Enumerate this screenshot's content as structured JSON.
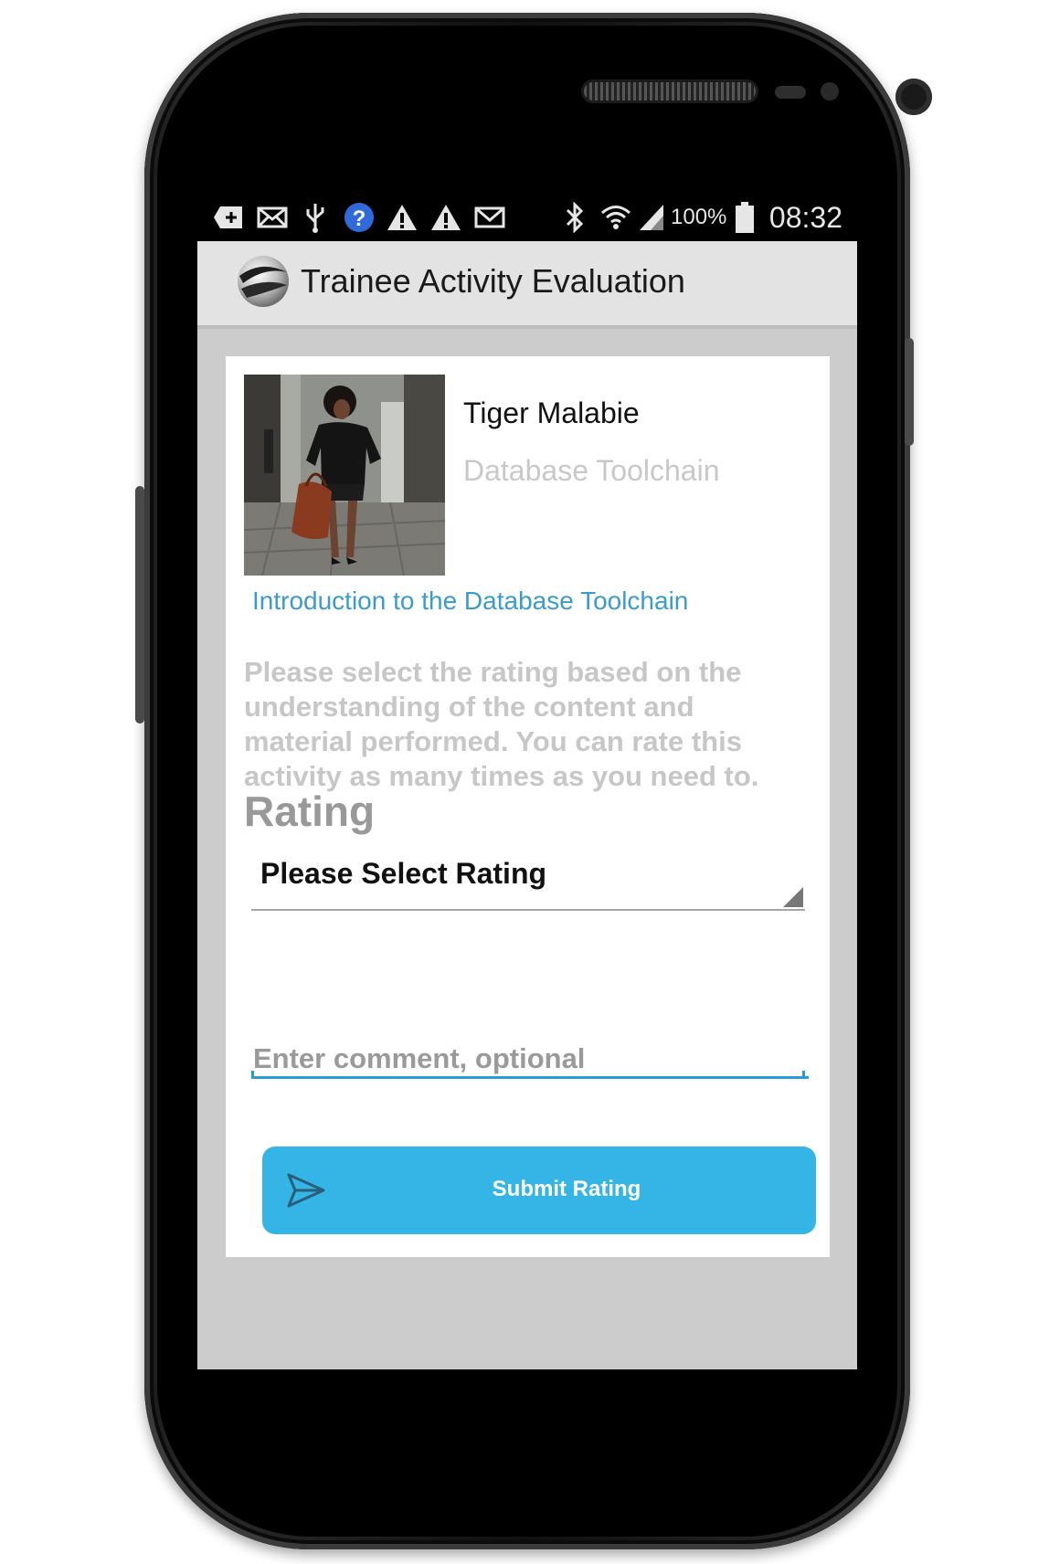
{
  "status_bar": {
    "battery_level": "100%",
    "time": "08:32",
    "left_icons": [
      "add-box-icon",
      "email-icon",
      "usb-icon",
      "help-icon",
      "warning-icon",
      "warning-icon",
      "gmail-icon"
    ],
    "right_icons": [
      "bluetooth-icon",
      "wifi-icon",
      "signal-icon",
      "battery-icon"
    ]
  },
  "app_bar": {
    "title": "Trainee Activity Evaluation",
    "logo_icon": "globe-swoosh-logo"
  },
  "trainee": {
    "name": "Tiger Malabie",
    "topic": "Database Toolchain"
  },
  "activity": {
    "title": "Introduction to the Database Toolchain"
  },
  "instructions": "Please select the rating based on the understanding of the content and material performed. You can rate this activity as many times as you need to.",
  "rating": {
    "heading": "Rating",
    "selected": "Please Select Rating"
  },
  "comment": {
    "placeholder": "Enter comment, optional",
    "value": ""
  },
  "submit": {
    "label": "Submit Rating",
    "icon": "send-icon"
  },
  "colors": {
    "accent": "#35b5e5",
    "link": "#3a9bd1",
    "app_bar": "#e3e3e3",
    "screen_background": "#cccccc"
  }
}
